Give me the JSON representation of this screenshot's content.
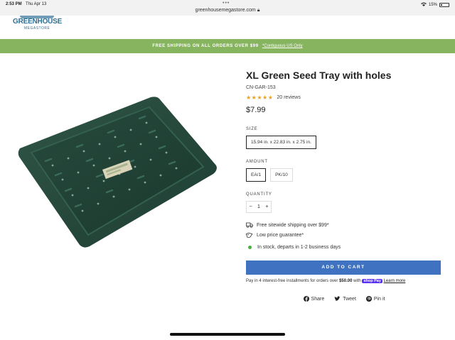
{
  "statusbar": {
    "time": "2:53 PM",
    "date": "Thu Apr 13",
    "dots": "•••",
    "url": "greenhousemegastore.com",
    "battery": "15%"
  },
  "header": {
    "logo_line1": "GREENHOUSE",
    "logo_line2": "MEGASTORE"
  },
  "announcement": {
    "text": "FREE SHIPPING ON ALL ORDERS OVER $99",
    "sub": "*Contiguous US Only"
  },
  "product": {
    "title": "XL Green Seed Tray with holes",
    "sku": "CN-GAR-153",
    "stars": "★★★★★",
    "reviews": "20 reviews",
    "price": "$7.99",
    "size_label": "SIZE",
    "sizes": [
      "15.94 in. x 22.83 in. x 2.75 in."
    ],
    "amount_label": "AMOUNT",
    "amounts": [
      "EA/1",
      "PK/10"
    ],
    "quantity_label": "QUANTITY",
    "quantity": {
      "minus": "−",
      "value": "1",
      "plus": "+"
    },
    "features": [
      "Free sitewide shipping over $99*",
      "Low price guarantee*"
    ],
    "stock": "In stock, departs in 1-2 business days",
    "add_to_cart": "ADD TO CART",
    "installments": {
      "prefix": "Pay in 4 interest-free installments for orders over",
      "amount": "$50.00",
      "with": "with",
      "brand": "shop Pay",
      "learn": "Learn more"
    },
    "share": [
      "Share",
      "Tweet",
      "Pin it"
    ]
  },
  "colors": {
    "accent_green": "#86b45f",
    "button_blue": "#3f72c0",
    "star": "#e9a21e",
    "stock_dot": "#45b23c",
    "shoppay": "#5a31f4"
  }
}
